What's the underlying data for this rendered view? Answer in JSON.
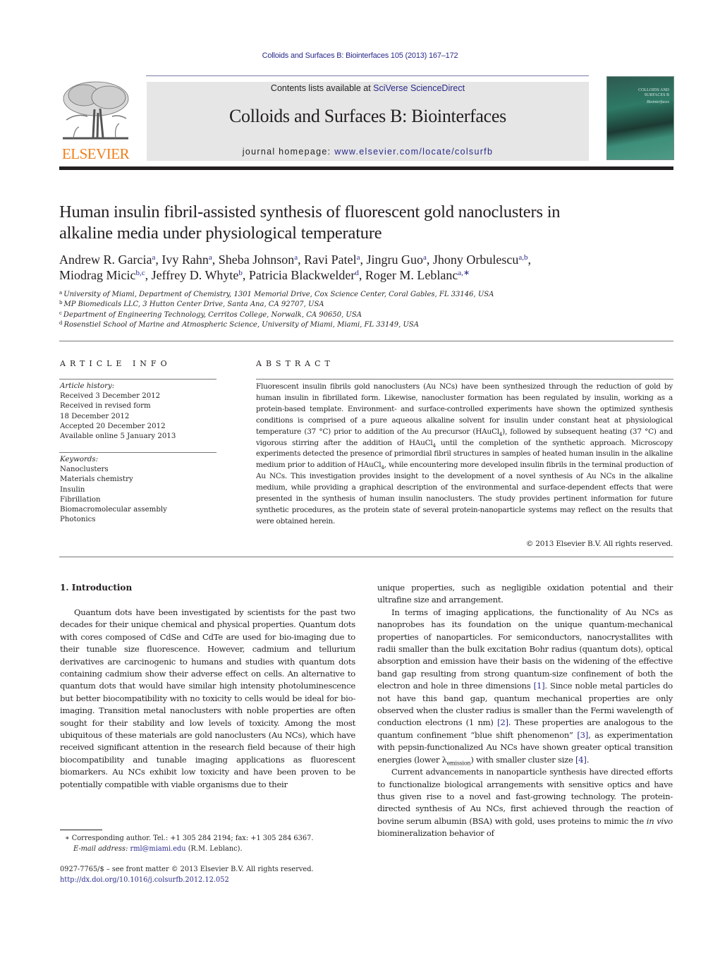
{
  "running_head": "Colloids and Surfaces B: Biointerfaces 105 (2013) 167–172",
  "masthead": {
    "contents_prefix": "Contents lists available at ",
    "contents_link": "SciVerse ScienceDirect",
    "journal_name": "Colloids and Surfaces B: Biointerfaces",
    "homepage_prefix": "journal homepage: ",
    "homepage_link": "www.elsevier.com/locate/colsurfb",
    "publisher_logo_text": "ELSEVIER",
    "cover_title_line1": "COLLOIDS AND",
    "cover_title_line2": "SURFACES B",
    "cover_subtitle": "Biointerfaces"
  },
  "colors": {
    "link": "#2a2a8c",
    "elsevier_orange": "#f07f1a",
    "masthead_bg": "#e6e6e6",
    "cover_green": "#2e7a66"
  },
  "article": {
    "title_line1": "Human insulin fibril-assisted synthesis of fluorescent gold nanoclusters in",
    "title_line2": "alkaline media under physiological temperature",
    "authors": [
      {
        "name": "Andrew R. Garcia",
        "aff": "a"
      },
      {
        "name": "Ivy Rahn",
        "aff": "a"
      },
      {
        "name": "Sheba Johnson",
        "aff": "a"
      },
      {
        "name": "Ravi Patel",
        "aff": "a"
      },
      {
        "name": "Jingru Guo",
        "aff": "a"
      },
      {
        "name": "Jhony Orbulescu",
        "aff": "a,b"
      },
      {
        "name": "Miodrag Micic",
        "aff": "b,c"
      },
      {
        "name": "Jeffrey D. Whyte",
        "aff": "b"
      },
      {
        "name": "Patricia Blackwelder",
        "aff": "d"
      },
      {
        "name": "Roger M. Leblanc",
        "aff": "a,∗"
      }
    ],
    "affiliations": [
      {
        "key": "a",
        "text": "University of Miami, Department of Chemistry, 1301 Memorial Drive, Cox Science Center, Coral Gables, FL 33146, USA"
      },
      {
        "key": "b",
        "text": "MP Biomedicals LLC, 3 Hutton Center Drive, Santa Ana, CA 92707, USA"
      },
      {
        "key": "c",
        "text": "Department of Engineering Technology, Cerritos College, Norwalk, CA 90650, USA"
      },
      {
        "key": "d",
        "text": "Rosenstiel School of Marine and Atmospheric Science, University of Miami, Miami, FL 33149, USA"
      }
    ]
  },
  "article_info": {
    "heading": "ARTICLE INFO",
    "history_label": "Article history:",
    "history": [
      "Received 3 December 2012",
      "Received in revised form",
      "18 December 2012",
      "Accepted 20 December 2012",
      "Available online 5 January 2013"
    ],
    "keywords_label": "Keywords:",
    "keywords": [
      "Nanoclusters",
      "Materials chemistry",
      "Insulin",
      "Fibrillation",
      "Biomacromolecular assembly",
      "Photonics"
    ]
  },
  "abstract": {
    "heading": "ABSTRACT",
    "part1": "Fluorescent insulin fibrils gold nanoclusters (Au NCs) have been synthesized through the reduction of gold by human insulin in fibrillated form. Likewise, nanocluster formation has been regulated by insulin, working as a protein-based template. Environment- and surface-controlled experiments have shown the optimized synthesis conditions is comprised of a pure aqueous alkaline solvent for insulin under constant heat at physiological temperature (37 °C) prior to addition of the Au precursor (HAuCl",
    "sub1": "4",
    "part2": "), followed by subsequent heating (37 °C) and vigorous stirring after the addition of HAuCl",
    "sub2": "4",
    "part3": " until the completion of the synthetic approach. Microscopy experiments detected the presence of primordial fibril structures in samples of heated human insulin in the alkaline medium prior to addition of HAuCl",
    "sub3": "4",
    "part4": ", while encountering more developed insulin fibrils in the terminal production of Au NCs. This investigation provides insight to the development of a novel synthesis of Au NCs in the alkaline medium, while providing a graphical description of the environmental and surface-dependent effects that were presented in the synthesis of human insulin nanoclusters. The study provides pertinent information for future synthetic procedures, as the protein state of several protein-nanoparticle systems may reflect on the results that were obtained herein.",
    "copyright": "© 2013 Elsevier B.V. All rights reserved."
  },
  "body": {
    "section_title": "1.  Introduction",
    "left_para1": "Quantum dots have been investigated by scientists for the past two decades for their unique chemical and physical properties. Quantum dots with cores composed of CdSe and CdTe are used for bio-imaging due to their tunable size fluorescence. However, cadmium and tellurium derivatives are carcinogenic to humans and studies with quantum dots containing cadmium show their adverse effect on cells. An alternative to quantum dots that would have similar high intensity photoluminescence but better biocompatibility with no toxicity to cells would be ideal for bio-imaging. Transition metal nanoclusters with noble properties are often sought for their stability and low levels of toxicity. Among the most ubiquitous of these materials are gold nanoclusters (Au NCs), which have received significant attention in the research field because of their high biocompatibility and tunable imaging applications as fluorescent biomarkers. Au NCs exhibit low toxicity and have been proven to be potentially compatible with viable organisms due to their",
    "right_para0": "unique properties, such as negligible oxidation potential and their ultrafine size and arrangement.",
    "right_para1_a": "In terms of imaging applications, the functionality of Au NCs as nanoprobes has its foundation on the unique quantum-mechanical properties of nanoparticles. For semiconductors, nanocrystallites with radii smaller than the bulk excitation Bohr radius (quantum dots), optical absorption and emission have their basis on the widening of the effective band gap resulting from strong quantum-size confinement of both the electron and hole in three dimensions ",
    "ref1": "[1]",
    "right_para1_b": ". Since noble metal particles do not have this band gap, quantum mechanical properties are only observed when the cluster radius is smaller than the Fermi wavelength of conduction electrons (1 nm) ",
    "ref2": "[2]",
    "right_para1_c": ". These properties are analogous to the quantum confinement “blue shift phenomenon” ",
    "ref3": "[3]",
    "right_para1_d": ", as experimentation with pepsin-functionalized Au NCs have shown greater optical transition energies (lower λ",
    "lambda_sub": "emission",
    "right_para1_e": ") with smaller cluster size ",
    "ref4": "[4]",
    "right_para1_f": ".",
    "right_para2_a": "Current advancements in nanoparticle synthesis have directed efforts to functionalize biological arrangements with sensitive optics and have thus given rise to a novel and fast-growing technology. The protein-directed synthesis of Au NCs, first achieved through the reaction of bovine serum albumin (BSA) with gold, uses proteins to mimic the ",
    "right_para2_it": "in vivo",
    "right_para2_b": " biomineralization behavior of"
  },
  "footnotes": {
    "corresponding": "∗  Corresponding author. Tel.: +1 305 284 2194; fax: +1 305 284 6367.",
    "email_label": "E-mail address:",
    "email": "rml@miami.edu",
    "email_suffix": " (R.M. Leblanc).",
    "front_matter": "0927-7765/$ – see front matter © 2013 Elsevier B.V. All rights reserved.",
    "doi": "http://dx.doi.org/10.1016/j.colsurfb.2012.12.052"
  }
}
